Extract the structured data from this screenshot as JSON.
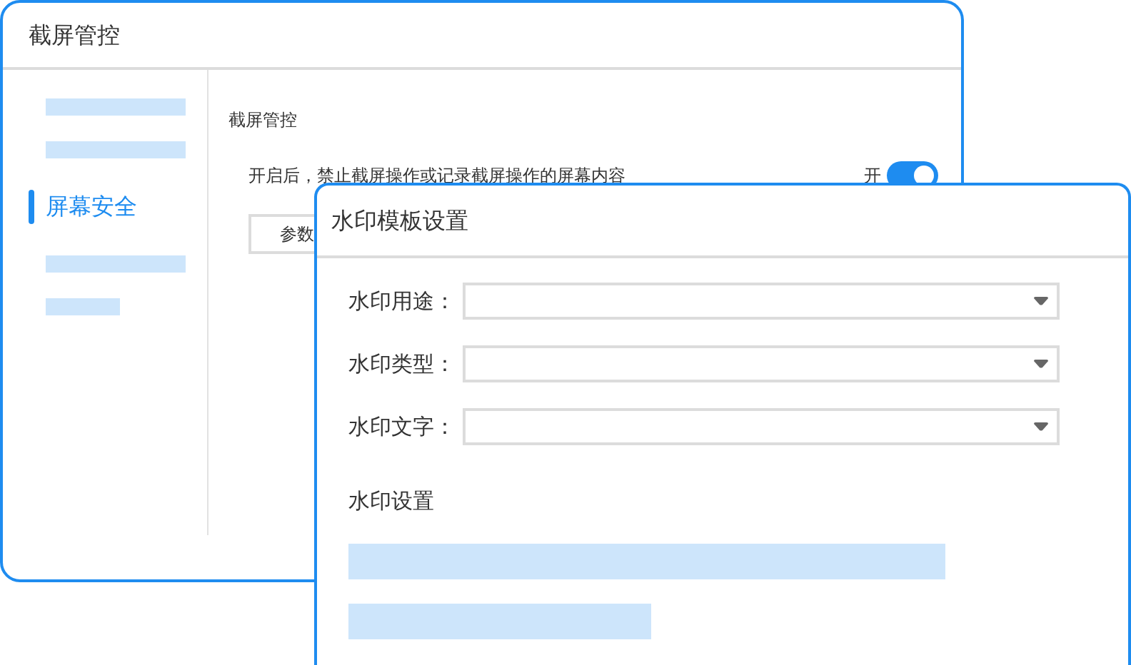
{
  "window": {
    "title": "截屏管控"
  },
  "sidebar": {
    "items": [
      {
        "kind": "placeholder",
        "short": false,
        "selected": false
      },
      {
        "kind": "placeholder",
        "short": false,
        "selected": false
      },
      {
        "kind": "text",
        "label": "屏幕安全",
        "selected": true
      },
      {
        "kind": "placeholder",
        "short": false,
        "selected": false
      },
      {
        "kind": "placeholder",
        "short": true,
        "selected": false
      }
    ]
  },
  "content": {
    "section_title": "截屏管控",
    "setting": {
      "description": "开启后，禁止截屏操作或记录截屏操作的屏幕内容",
      "state_label": "开",
      "on": true
    },
    "button": "参数"
  },
  "dialog": {
    "title": "水印模板设置",
    "fields": [
      {
        "label": "水印用途："
      },
      {
        "label": "水印类型："
      },
      {
        "label": "水印文字："
      }
    ],
    "section_title": "水印设置",
    "placeholders": [
      {
        "short": false
      },
      {
        "short": true
      }
    ]
  }
}
